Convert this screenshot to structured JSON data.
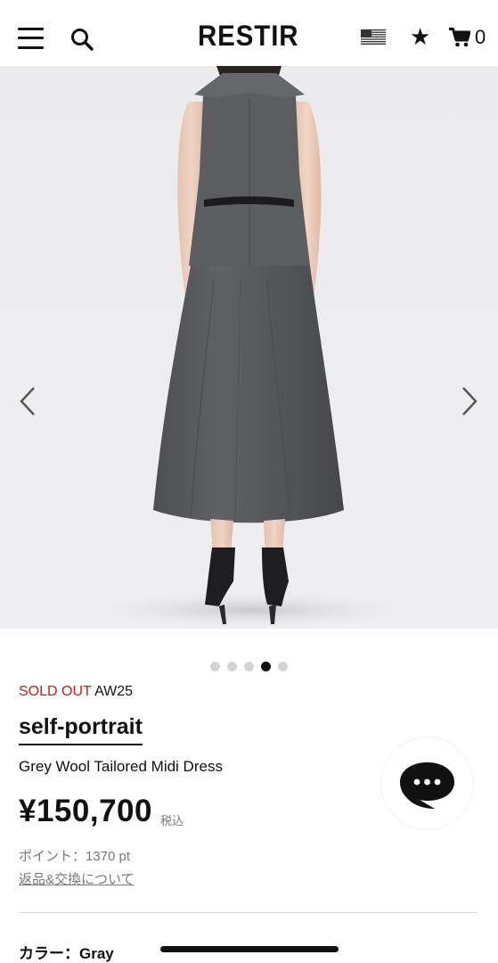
{
  "header": {
    "logo": "RESTIR",
    "cart_count": "0",
    "icons": [
      "menu-icon",
      "search-icon",
      "us-flag-icon",
      "star-icon",
      "cart-icon"
    ]
  },
  "gallery": {
    "slide_count": 5,
    "active_index": 3
  },
  "product": {
    "status": "SOLD OUT",
    "season": "AW25",
    "brand": "self-portrait",
    "name": "Grey Wool Tailored Midi Dress",
    "price": "¥150,700",
    "tax_note": "税込",
    "points": "ポイント：1370 pt",
    "returns_link": "返品&交換について",
    "color_label": "カラー：Gray"
  },
  "colors": {
    "sold_out": "#c0201e",
    "dress": "#55575b",
    "background": "#ececee"
  }
}
